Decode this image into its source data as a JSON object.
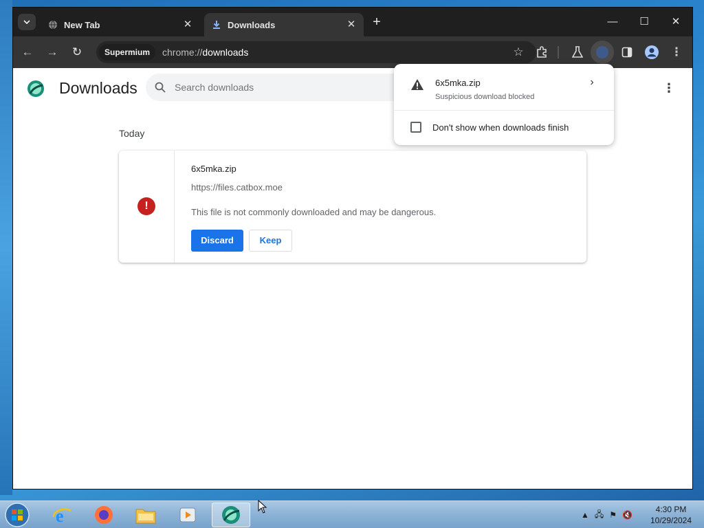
{
  "browser": {
    "tabs": [
      {
        "title": "New Tab",
        "active": false,
        "icon": "globe-icon"
      },
      {
        "title": "Downloads",
        "active": true,
        "icon": "download-icon"
      }
    ],
    "new_tab_label": "+",
    "site_chip": "Supermium",
    "url_prefix": "chrome://",
    "url_path": "downloads"
  },
  "page": {
    "title": "Downloads",
    "search_placeholder": "Search downloads",
    "section_label": "Today",
    "download": {
      "file_name": "6x5mka.zip",
      "source_url": "https://files.catbox.moe",
      "warning": "This file is not commonly downloaded and may be dangerous.",
      "discard_label": "Discard",
      "keep_label": "Keep"
    }
  },
  "popup": {
    "file_name": "6x5mka.zip",
    "status": "Suspicious download blocked",
    "checkbox_label": "Don't show when downloads finish",
    "checkbox_checked": false
  },
  "taskbar": {
    "time": "4:30 PM",
    "date": "10/29/2024"
  },
  "colors": {
    "accent": "#1a73e8",
    "danger": "#c5221f",
    "tab_active": "#353535",
    "tabstrip": "#1f1f1f"
  }
}
